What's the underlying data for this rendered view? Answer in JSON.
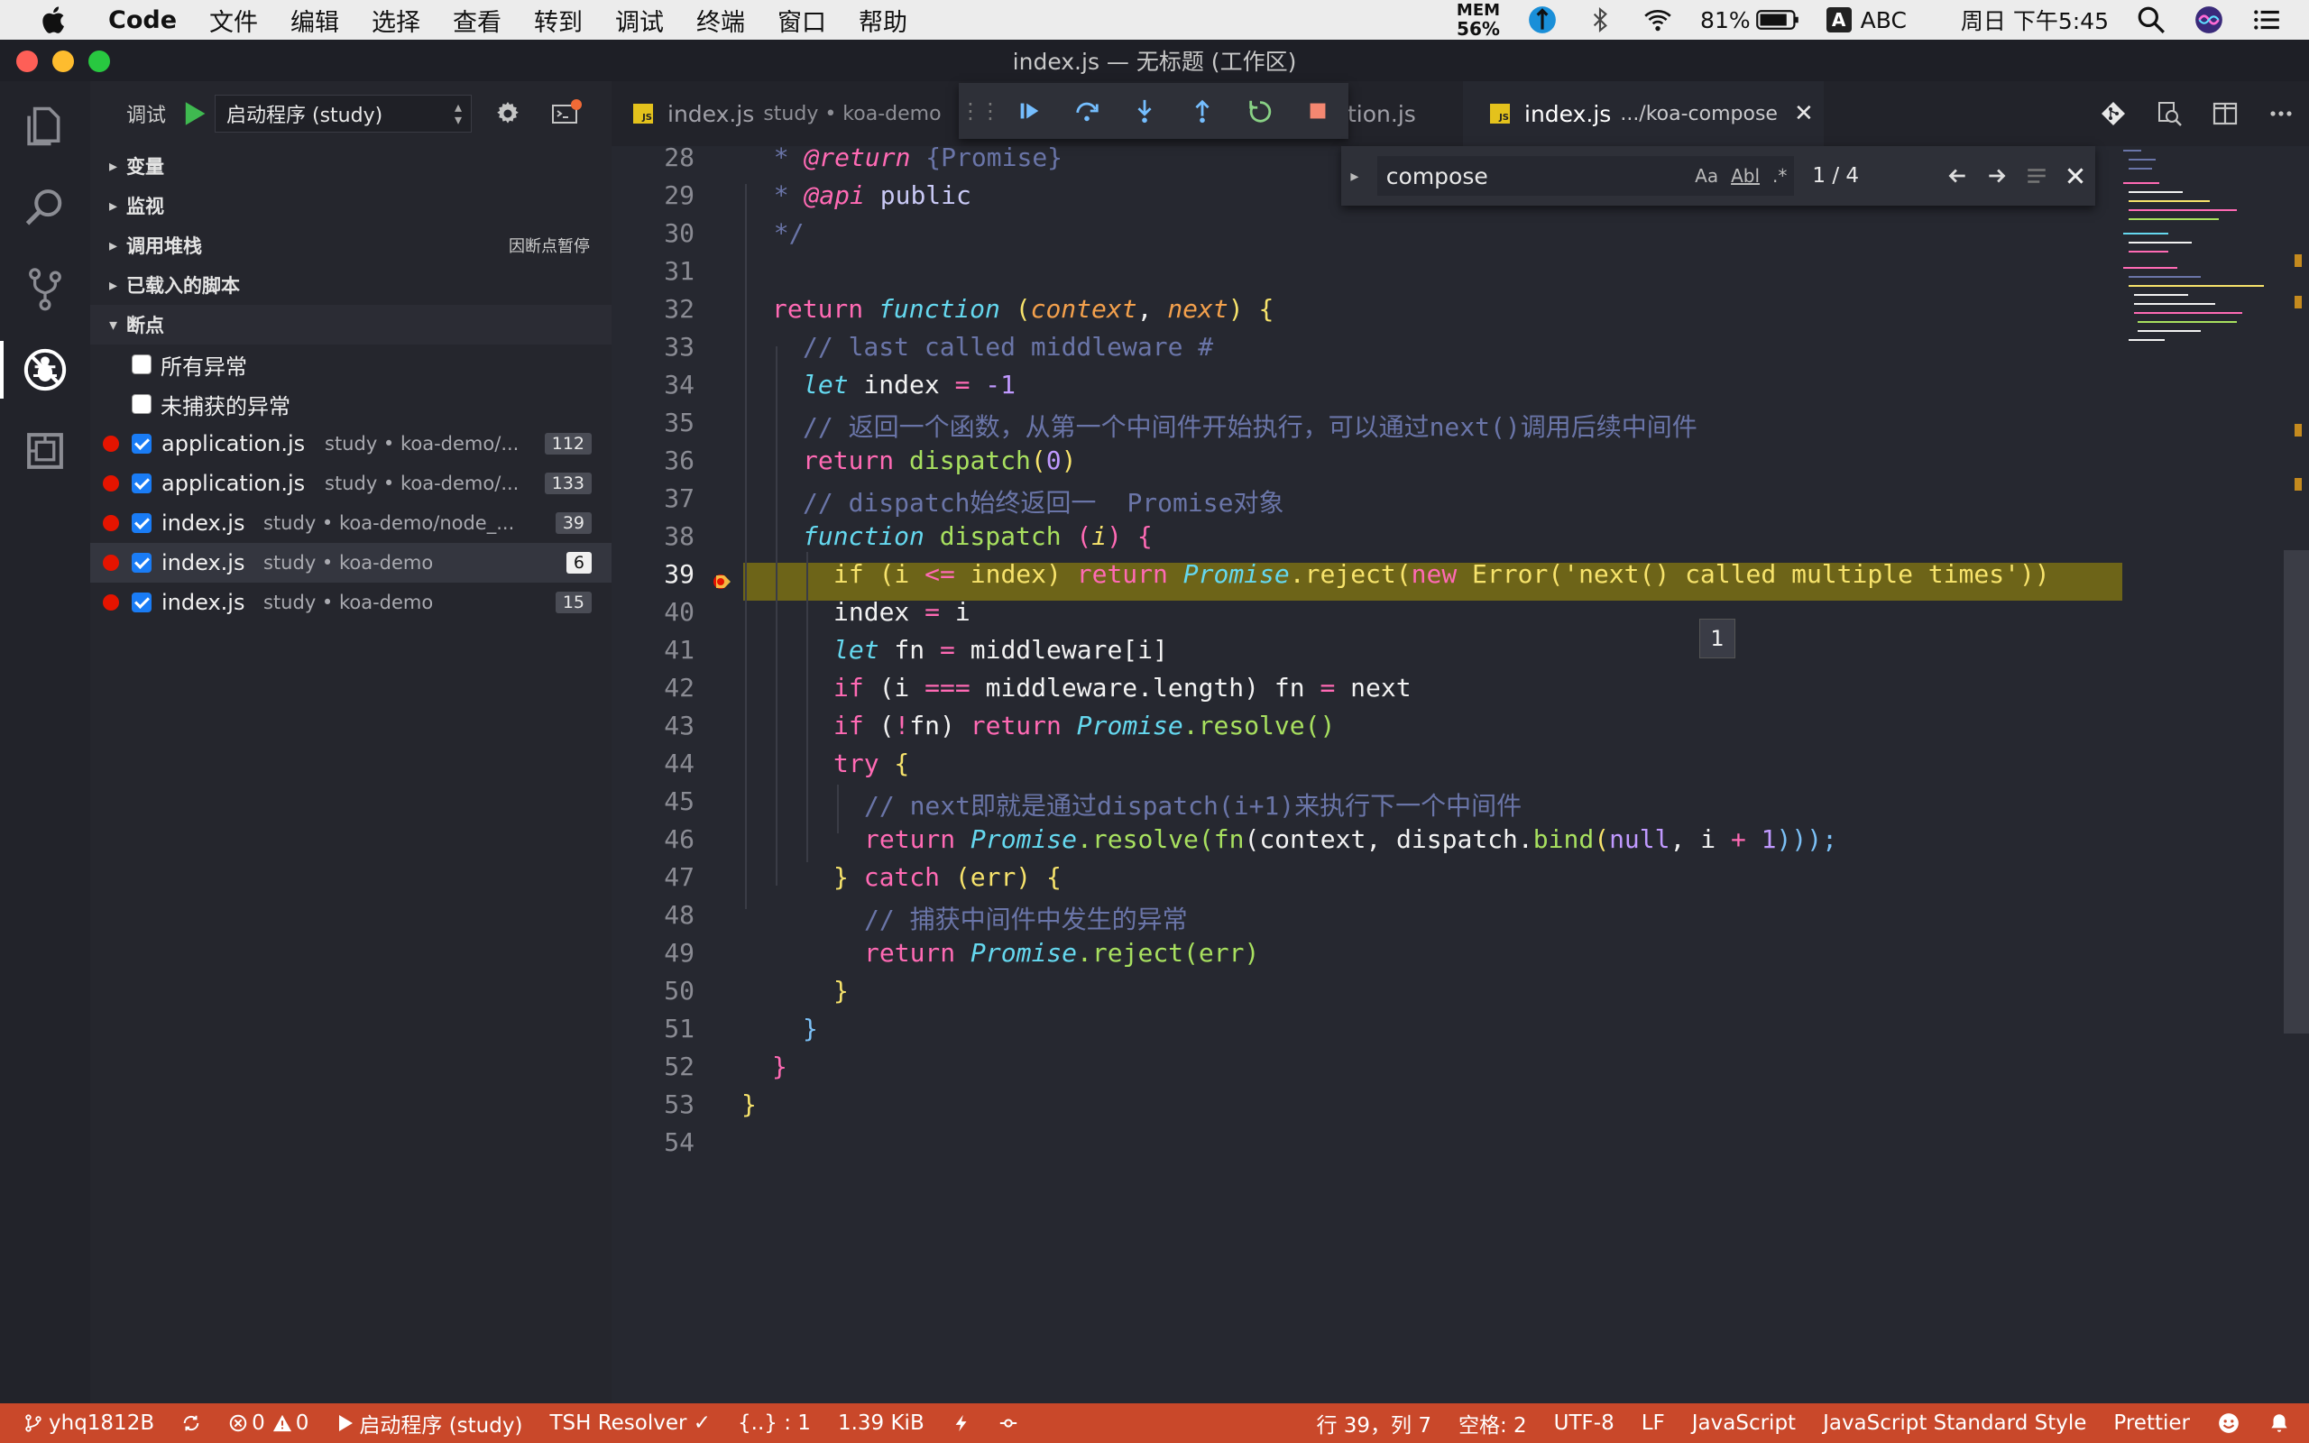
{
  "menubar": {
    "app_name": "Code",
    "items": [
      "文件",
      "编辑",
      "选择",
      "查看",
      "转到",
      "调试",
      "终端",
      "窗口",
      "帮助"
    ],
    "mem_label": "MEM",
    "mem_value": "56%",
    "battery": "81%",
    "input_badge": "A",
    "input_source": "ABC",
    "clock": "周日 下午5:45"
  },
  "window": {
    "title": "index.js — 无标题 (工作区)"
  },
  "debug_view": {
    "label": "调试",
    "config": "启动程序 (study)"
  },
  "sections": {
    "variables": "变量",
    "watch": "监视",
    "callstack": "调用堆栈",
    "callstack_status": "因断点暂停",
    "loaded_scripts": "已载入的脚本",
    "breakpoints": "断点"
  },
  "exceptions": [
    {
      "label": "所有异常",
      "checked": false
    },
    {
      "label": "未捕获的异常",
      "checked": false
    }
  ],
  "breakpoints": [
    {
      "file": "application.js",
      "path": "study • koa-demo/...",
      "line": "112"
    },
    {
      "file": "application.js",
      "path": "study • koa-demo/...",
      "line": "133"
    },
    {
      "file": "index.js",
      "path": "study • koa-demo/node_...",
      "line": "39"
    },
    {
      "file": "index.js",
      "path": "study • koa-demo",
      "line": "6"
    },
    {
      "file": "index.js",
      "path": "study • koa-demo",
      "line": "15"
    }
  ],
  "tabs": [
    {
      "name": "index.js",
      "desc": "study • koa-demo"
    },
    {
      "name": "tion.js",
      "desc": ""
    },
    {
      "name": "index.js",
      "desc": ".../koa-compose",
      "close": "✕"
    }
  ],
  "find": {
    "query": "compose",
    "opt_case": "Aa",
    "opt_word": "Abl",
    "opt_regex": ".*",
    "count": "1 / 4"
  },
  "hover_value": "1",
  "line_numbers": [
    "28",
    "29",
    "30",
    "31",
    "32",
    "33",
    "34",
    "35",
    "36",
    "37",
    "38",
    "39",
    "40",
    "41",
    "42",
    "43",
    "44",
    "45",
    "46",
    "47",
    "48",
    "49",
    "50",
    "51",
    "52",
    "53",
    "54"
  ],
  "code": {
    "l28_a": "  * ",
    "l28_b": "@return",
    "l28_c": " {Promise}",
    "l29_a": "  * ",
    "l29_b": "@api",
    "l29_c": " public",
    "l30": "  */",
    "l32_a": "return",
    "l32_b": "function",
    "l32_c": "(",
    "l32_d": "context",
    "l32_e": ", ",
    "l32_f": "next",
    "l32_g": ") {",
    "l33": "// last called middleware #",
    "l34_a": "let",
    "l34_b": " index ",
    "l34_c": "=",
    "l34_d": " -1",
    "l35": "// 返回一个函数，从第一个中间件开始执行，可以通过next()调用后续中间件",
    "l36_a": "return",
    "l36_b": "dispatch",
    "l36_c": "(",
    "l36_d": "0",
    "l36_e": ")",
    "l37_a": "// dispatch始终返回一",
    "l37_b": "Promise对象",
    "l38_a": "function",
    "l38_b": "dispatch",
    "l38_c": " (",
    "l38_d": "i",
    "l38_e": ") {",
    "l39_a": "if",
    "l39_b": " (i ",
    "l39_c": "<=",
    "l39_d": " index) ",
    "l39_e": "return",
    "l39_f": "Promise",
    "l39_g": ".reject(",
    "l39_h": "new",
    "l39_i": " Error(",
    "l39_j": "'next() called multiple times'",
    "l39_k": "))",
    "l40_a": "index ",
    "l40_b": "=",
    "l40_c": " i",
    "l41_a": "let",
    "l41_b": " fn ",
    "l41_c": "=",
    "l41_d": " middleware[i]",
    "l42_a": "if",
    "l42_b": " (i ",
    "l42_c": "===",
    "l42_d": " middleware.length) fn ",
    "l42_e": "=",
    "l42_f": " next",
    "l43_a": "if",
    "l43_b": " (",
    "l43_c": "!",
    "l43_d": "fn) ",
    "l43_e": "return",
    "l43_f": "Promise",
    "l43_g": ".resolve()",
    "l44_a": "try",
    "l44_b": " {",
    "l45": "// next即就是通过dispatch(i+1)来执行下一个中间件",
    "l46_a": "return",
    "l46_b": "Promise",
    "l46_c": ".resolve(",
    "l46_d": "fn",
    "l46_e": "(context, dispatch.",
    "l46_f": "bind",
    "l46_g": "(",
    "l46_h": "null",
    "l46_i": ", i ",
    "l46_j": "+",
    "l46_k": " 1",
    "l46_l": ")));",
    "l47_a": "}",
    "l47_b": " catch",
    "l47_c": " (err) {",
    "l48": "// 捕获中间件中发生的异常",
    "l49_a": "return",
    "l49_b": "Promise",
    "l49_c": ".reject(err)",
    "l50": "}",
    "l51": "}",
    "l52": "}",
    "l53": "}"
  },
  "status": {
    "branch": "yhq1812B",
    "errors": "0",
    "warnings": "0",
    "debug_config": "启动程序 (study)",
    "tsh": "TSH Resolver ✓",
    "braces": "{..} : 1",
    "size": "1.39 KiB",
    "position": "行 39，列 7",
    "spaces": "空格: 2",
    "encoding": "UTF-8",
    "eol": "LF",
    "language": "JavaScript",
    "linter": "JavaScript Standard Style",
    "formatter": "Prettier"
  },
  "colors": {
    "statusbar": "#c9482a",
    "breakpoint": "#e51400",
    "highlight_line": "#6d6418"
  }
}
